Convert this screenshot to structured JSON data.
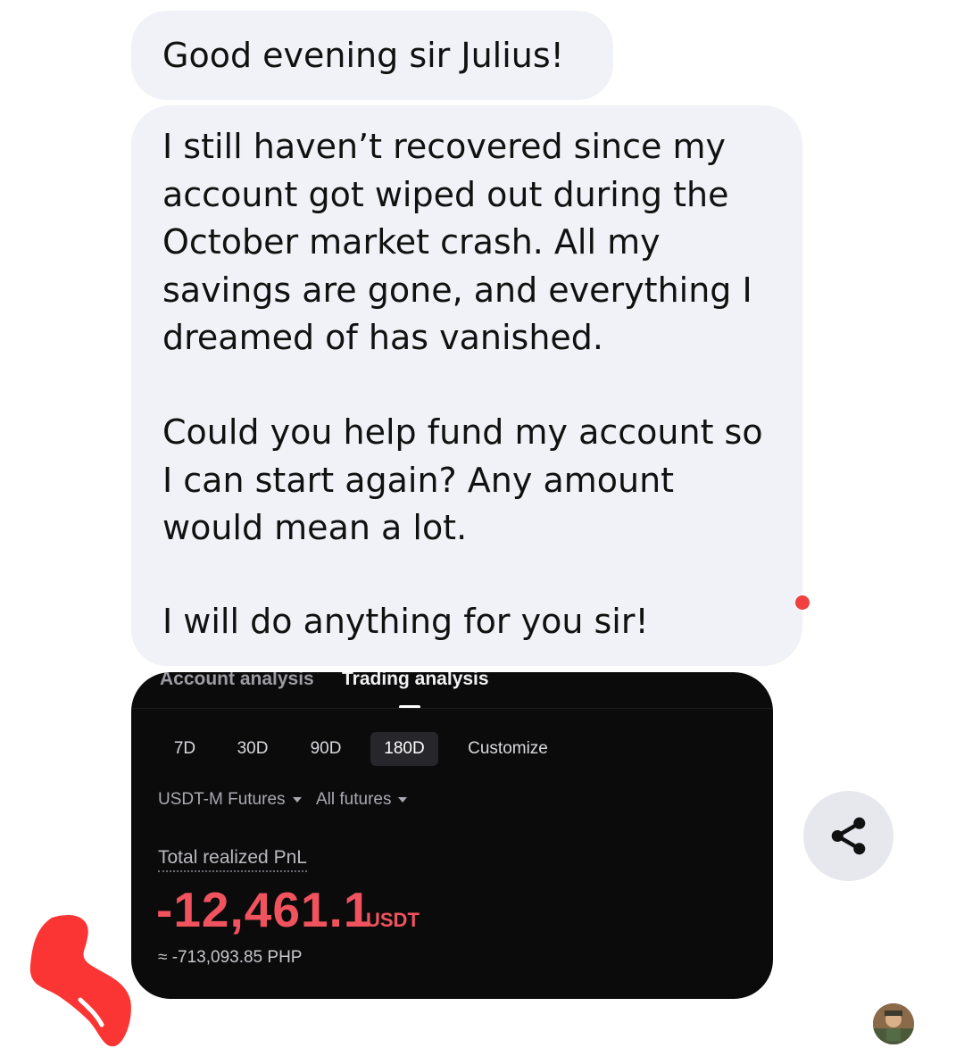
{
  "messages": [
    {
      "text": "Good evening sir Julius!"
    },
    {
      "paragraphs": [
        "I still haven’t recovered since my\naccount got wiped out during the\nOctober market crash. All my\nsavings are gone, and everything I\ndreamed of has vanished.",
        "Could you help fund my account so\nI can start again? Any amount\nwould mean a lot.",
        "I will do anything for you sir!"
      ]
    }
  ],
  "screenshot": {
    "tabs": [
      "Account analysis",
      "Trading analysis"
    ],
    "active_tab": "Trading analysis",
    "periods": [
      "7D",
      "30D",
      "90D",
      "180D",
      "Customize"
    ],
    "active_period": "180D",
    "filters": [
      "USDT-M Futures",
      "All futures"
    ],
    "pnl_label": "Total realized PnL",
    "pnl_value": "-12,461.1",
    "pnl_unit": "USDT",
    "pnl_php": "≈ -713,093.85 PHP",
    "pnl_color": "#f0535d"
  },
  "share_button": {
    "icon": "share-icon"
  },
  "colors": {
    "bubble": "#f1f2f7",
    "unread_dot": "#f0403f",
    "redaction": "#fb3434"
  }
}
